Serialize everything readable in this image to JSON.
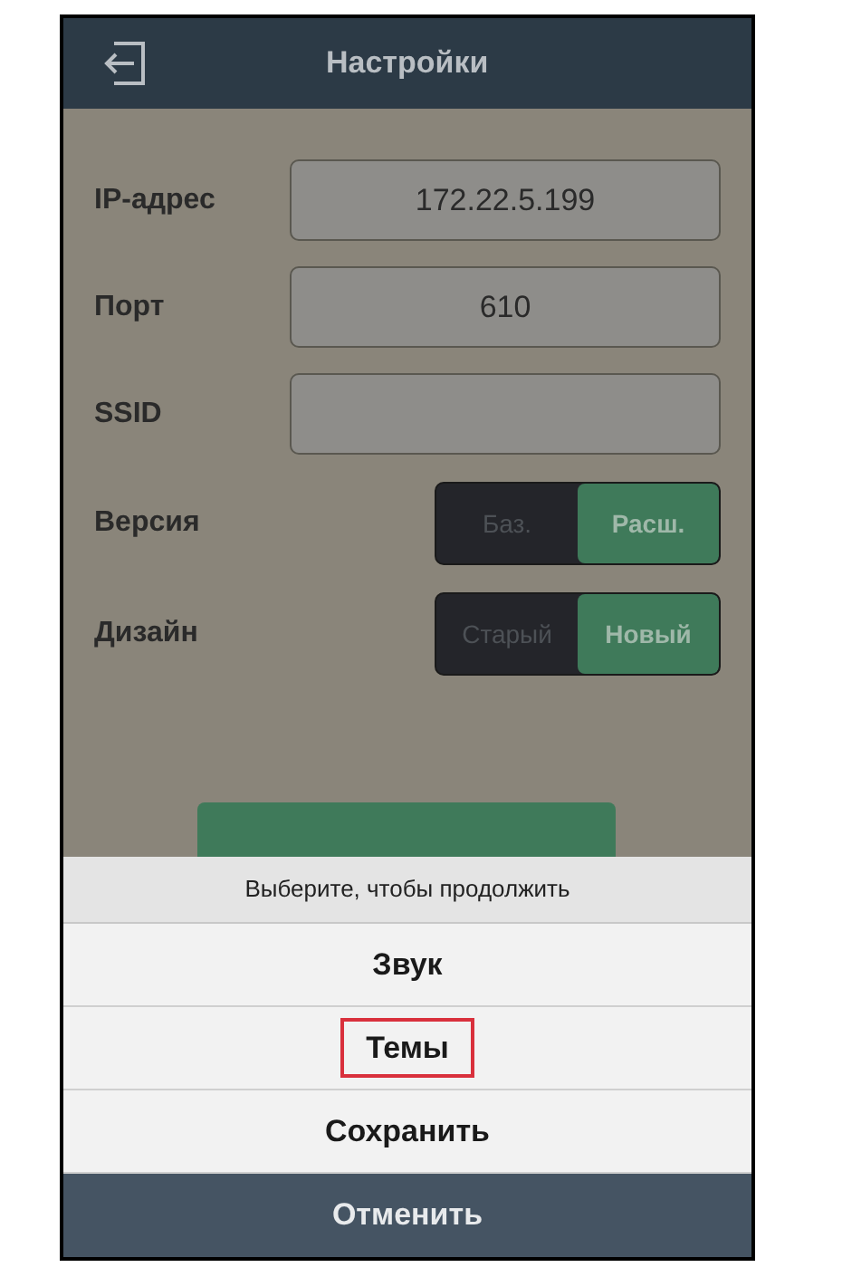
{
  "header": {
    "title": "Настройки"
  },
  "fields": [
    {
      "label": "IP-адрес",
      "value": "172.22.5.199"
    },
    {
      "label": "Порт",
      "value": "610"
    },
    {
      "label": "SSID"
    }
  ],
  "toggles": [
    {
      "label": "Версия",
      "options": [
        {
          "label": "Баз.",
          "selected": false
        },
        {
          "label": "Расш.",
          "selected": true
        }
      ]
    },
    {
      "label": "Дизайн",
      "options": [
        {
          "label": "Старый",
          "selected": false
        },
        {
          "label": "Новый",
          "selected": true
        }
      ]
    }
  ],
  "sheet": {
    "title": "Выберите, чтобы продолжить",
    "items": [
      {
        "kind": "option",
        "label": "Звук"
      },
      {
        "kind": "option",
        "label": "Темы",
        "highlighted": true
      },
      {
        "kind": "option",
        "label": "Сохранить"
      },
      {
        "kind": "cancel",
        "label": "Отменить"
      }
    ]
  }
}
